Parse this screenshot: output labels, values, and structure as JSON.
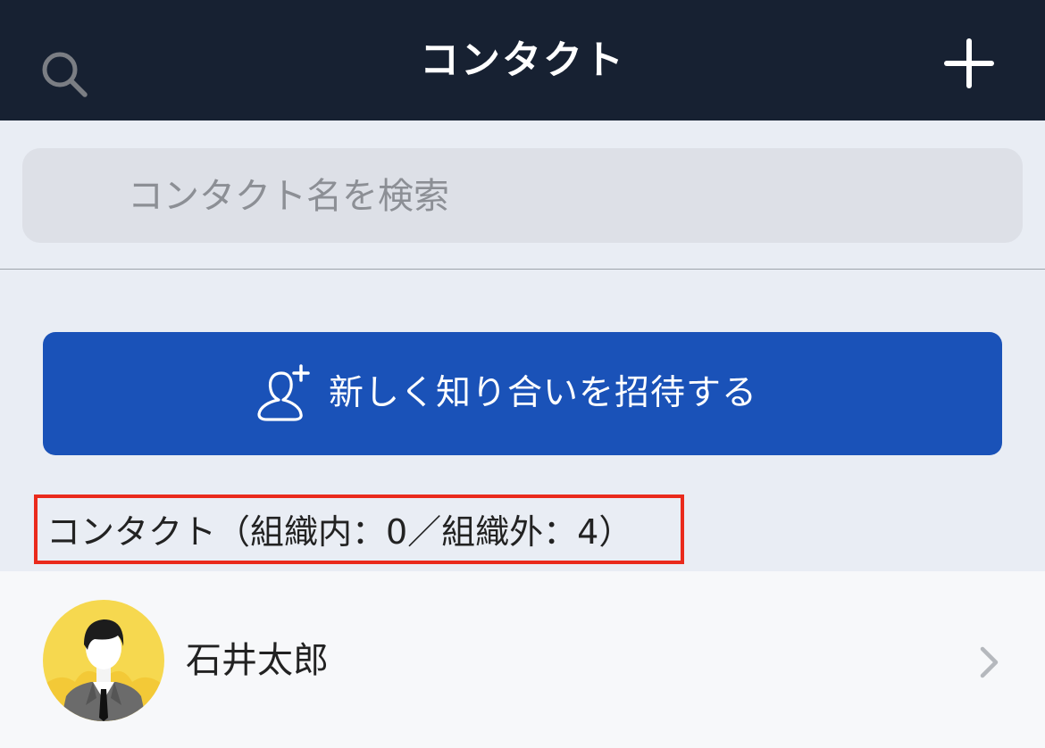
{
  "navbar": {
    "title": "コンタクト",
    "add_icon": "plus-icon"
  },
  "search": {
    "placeholder": "コンタクト名を検索",
    "value": "",
    "icon": "search-icon"
  },
  "invite_button": {
    "label": "新しく知り合いを招待する",
    "icon": "add-person-icon"
  },
  "section": {
    "label": "コンタクト（組織内：0／組織外：4）"
  },
  "contacts": [
    {
      "name": "石井太郎",
      "avatar": "avatar-man-icon"
    }
  ],
  "colors": {
    "navbar_bg": "#172132",
    "page_bg": "#e9edf4",
    "button_bg": "#1a52b8",
    "highlight_border": "#ea2a1c",
    "avatar_bg": "#f6d84f"
  }
}
